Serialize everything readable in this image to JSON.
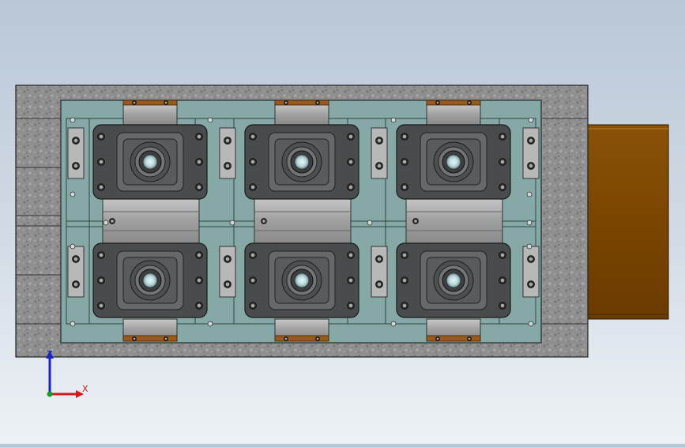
{
  "viewport": {
    "view_orientation": "top",
    "colors": {
      "background_top": "#b9c7d6",
      "background_bottom": "#eef2f6",
      "base_plate": "#8e8e8e",
      "fixture_plate": "#86a8a6",
      "jaw_blocks": "#a3a3a3",
      "part_body": "#58595b",
      "slide_rail": "#7a4500",
      "tab_copper": "#9a5a1e"
    }
  },
  "triad": {
    "z_label": "Z",
    "x_label": "X",
    "z_color": "#1a23c8",
    "x_color": "#d41a1a",
    "origin_color": "#1a9a2a"
  }
}
